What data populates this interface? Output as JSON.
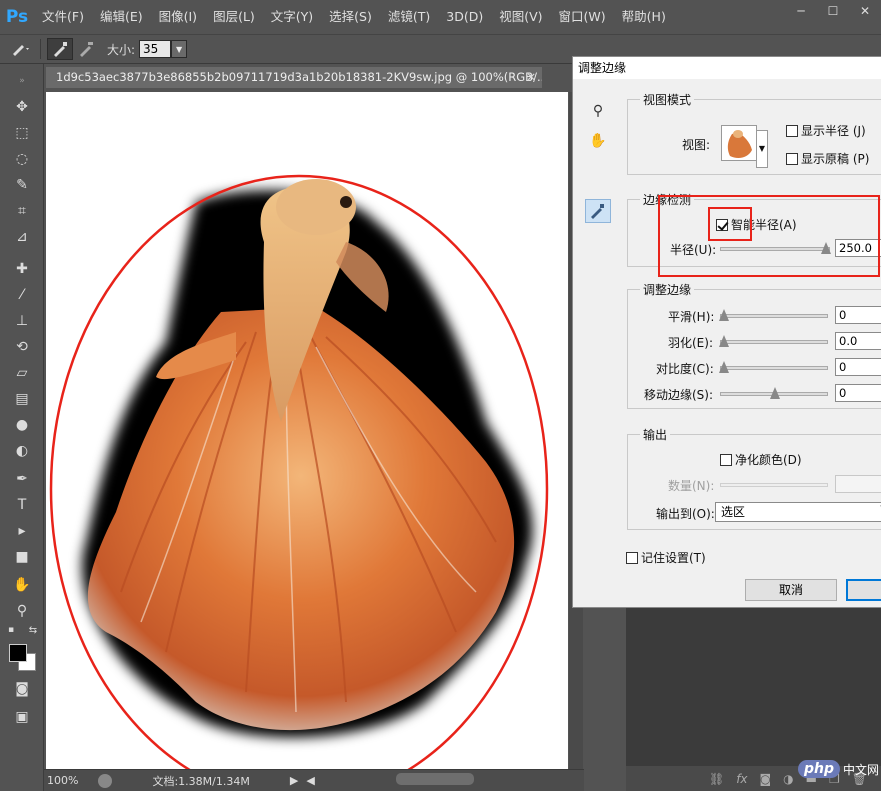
{
  "app": {
    "logo": "Ps"
  },
  "menu": [
    "文件(F)",
    "编辑(E)",
    "图像(I)",
    "图层(L)",
    "文字(Y)",
    "选择(S)",
    "滤镜(T)",
    "3D(D)",
    "视图(V)",
    "窗口(W)",
    "帮助(H)"
  ],
  "options_bar": {
    "size_label": "大小:",
    "size_value": "35"
  },
  "document": {
    "tab_title": "1d9c53aec3877b3e86855b2b09711719d3a1b20b18381-2KV9sw.jpg @ 100%(RGB/...",
    "zoom": "100%",
    "doc_info": "文档:1.38M/1.34M"
  },
  "dialog": {
    "title": "调整边缘",
    "view_mode": {
      "group_title": "视图模式",
      "view_label": "视图:",
      "show_radius": "显示半径 (J)",
      "show_original": "显示原稿 (P)"
    },
    "edge_detection": {
      "group_title": "边缘检测",
      "smart_radius": "智能半径(A)",
      "smart_radius_checked": true,
      "radius_label": "半径(U):",
      "radius_value": "250.0",
      "radius_fraction": 1.0
    },
    "adjust_edge": {
      "group_title": "调整边缘",
      "smooth_label": "平滑(H):",
      "smooth_value": "0",
      "feather_label": "羽化(E):",
      "feather_value": "0.0",
      "contrast_label": "对比度(C):",
      "contrast_value": "0",
      "shift_label": "移动边缘(S):",
      "shift_value": "0"
    },
    "output": {
      "group_title": "输出",
      "decontaminate": "净化颜色(D)",
      "amount_label": "数量(N):",
      "output_to_label": "输出到(O):",
      "output_to_value": "选区"
    },
    "remember": "记住设置(T)",
    "cancel": "取消"
  },
  "watermark": {
    "php": "php",
    "cn": "中文网"
  },
  "colors": {
    "annotation_red": "#e8231a",
    "accent_blue": "#31a8ff"
  }
}
